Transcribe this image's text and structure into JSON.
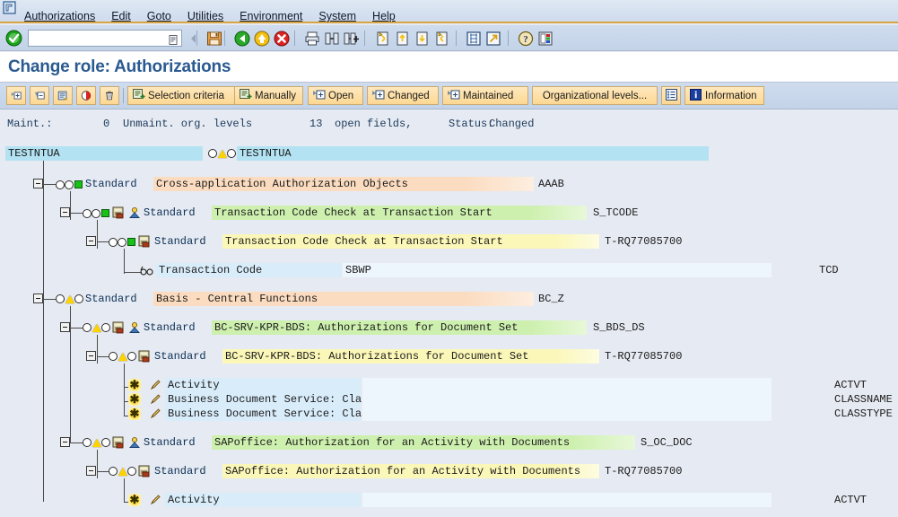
{
  "window": {
    "system_icon": "sap-window-icon"
  },
  "menubar": {
    "items": [
      {
        "label": "Authorizations",
        "accel": 0
      },
      {
        "label": "Edit",
        "accel": 0
      },
      {
        "label": "Goto",
        "accel": 0
      },
      {
        "label": "Utilities",
        "accel": 0
      },
      {
        "label": "Environment",
        "accel": 4
      },
      {
        "label": "System",
        "accel": 0
      },
      {
        "label": "Help",
        "accel": 0
      }
    ]
  },
  "toolbar": {
    "ok_icon": "enter-check-icon",
    "command_field": {
      "value": "",
      "placeholder": ""
    },
    "command_dropdown_icon": "command-history-icon",
    "buttons": [
      {
        "name": "back-small-icon",
        "glyph": "◀"
      },
      {
        "name": "save-icon",
        "glyph": "💾"
      },
      {
        "name": "back-green-icon",
        "glyph": "⬅"
      },
      {
        "name": "exit-yellow-icon",
        "glyph": "⬆"
      },
      {
        "name": "cancel-red-icon",
        "glyph": "✖"
      },
      {
        "name": "print-icon",
        "glyph": "🖨"
      },
      {
        "name": "find-icon",
        "glyph": "🔍"
      },
      {
        "name": "find-next-icon",
        "glyph": "🔎"
      },
      {
        "name": "first-page-icon",
        "glyph": "⏮"
      },
      {
        "name": "previous-page-icon",
        "glyph": "⬆"
      },
      {
        "name": "next-page-icon",
        "glyph": "⬇"
      },
      {
        "name": "last-page-icon",
        "glyph": "⏭"
      },
      {
        "name": "create-session-icon",
        "glyph": "▦"
      },
      {
        "name": "create-shortcut-icon",
        "glyph": "↗"
      },
      {
        "name": "help-icon",
        "glyph": "?"
      },
      {
        "name": "customize-local-layout-icon",
        "glyph": "▤"
      }
    ]
  },
  "title": {
    "text": "Change role: Authorizations"
  },
  "app_toolbar": {
    "icon_buttons": [
      {
        "name": "expand-all-button",
        "icon": "expand-node-icon"
      },
      {
        "name": "collapse-all-button",
        "icon": "collapse-node-icon"
      },
      {
        "name": "display-legend-button",
        "icon": "legend-icon"
      },
      {
        "name": "deactivate-button",
        "icon": "traffic-light-icon"
      },
      {
        "name": "delete-button",
        "icon": "trash-icon"
      }
    ],
    "labeled_buttons": [
      {
        "name": "selection-criteria-button",
        "label": "Selection criteria",
        "icon": "selection-icon"
      },
      {
        "name": "manually-button",
        "label": "Manually",
        "icon": "manual-icon"
      },
      {
        "name": "open-button",
        "label": "Open",
        "icon": "open-node-icon"
      },
      {
        "name": "changed-button",
        "label": "Changed",
        "icon": "changed-node-icon"
      },
      {
        "name": "maintained-button",
        "label": "Maintained",
        "icon": "maintained-node-icon"
      },
      {
        "name": "organizational-levels-button",
        "label": "Organizational levels...",
        "icon": ""
      },
      {
        "name": "utilities-list-button",
        "label": "",
        "icon": "list-icon"
      },
      {
        "name": "information-button",
        "label": "Information",
        "icon": "info-icon"
      }
    ]
  },
  "status_line": {
    "maint_label": "Maint.:",
    "unmaint_count": "0",
    "unmaint_label": "Unmaint. org. levels",
    "open_count": "13",
    "open_label": "open fields,",
    "status_label": "Status:",
    "status_value": "Changed"
  },
  "tree": {
    "role_name_left": "TESTNTUA",
    "role_name_right": "TESTNTUA",
    "role_status_icons": [
      "circle-white",
      "triangle-yellow",
      "circle-white"
    ],
    "rows": [
      {
        "kind": "role",
        "depth": 0,
        "left_text": "TESTNTUA",
        "status": [
          "circle-white",
          "triangle-yellow",
          "circle-white"
        ],
        "text": "TESTNTUA",
        "tech": ""
      },
      {
        "kind": "class",
        "depth": 1,
        "status": [
          "circle-white",
          "circle-white",
          "square-green"
        ],
        "standard": "Standard",
        "text": "Cross-application Authorization Objects",
        "tech": "AAAB"
      },
      {
        "kind": "object",
        "depth": 2,
        "status": [
          "circle-white",
          "circle-white",
          "square-green"
        ],
        "icons": [
          "auth-object-icon",
          "person-icon"
        ],
        "standard": "Standard",
        "text": "Transaction Code Check at Transaction Start",
        "tech": "S_TCODE"
      },
      {
        "kind": "auth",
        "depth": 3,
        "status": [
          "circle-white",
          "circle-white",
          "square-green"
        ],
        "icons": [
          "authorization-icon"
        ],
        "standard": "Standard",
        "text": "Transaction Code Check at Transaction Start",
        "tech": "T-RQ77085700"
      },
      {
        "kind": "field",
        "depth": 4,
        "icons": [
          "read-only-glasses-icon"
        ],
        "text": "Transaction Code",
        "value": "SBWP",
        "tech": "TCD"
      },
      {
        "kind": "class",
        "depth": 1,
        "status": [
          "circle-white",
          "triangle-yellow",
          "circle-white"
        ],
        "standard": "Standard",
        "text": "Basis - Central Functions",
        "tech": "BC_Z"
      },
      {
        "kind": "object",
        "depth": 2,
        "status": [
          "circle-white",
          "triangle-yellow",
          "circle-white"
        ],
        "icons": [
          "auth-object-icon",
          "person-icon"
        ],
        "standard": "Standard",
        "text": "BC-SRV-KPR-BDS: Authorizations for Document Set",
        "tech": "S_BDS_DS"
      },
      {
        "kind": "auth",
        "depth": 3,
        "status": [
          "circle-white",
          "triangle-yellow",
          "circle-white"
        ],
        "icons": [
          "authorization-icon"
        ],
        "standard": "Standard",
        "text": "BC-SRV-KPR-BDS: Authorizations for Document Set",
        "tech": "T-RQ77085700"
      },
      {
        "kind": "field",
        "depth": 4,
        "icons": [
          "star-icon",
          "pencil-icon"
        ],
        "text": "Activity",
        "value": "",
        "tech": "ACTVT"
      },
      {
        "kind": "field",
        "depth": 4,
        "icons": [
          "star-icon",
          "pencil-icon"
        ],
        "text": "Business Document Service: Cla",
        "value": "",
        "tech": "CLASSNAME"
      },
      {
        "kind": "field",
        "depth": 4,
        "icons": [
          "star-icon",
          "pencil-icon"
        ],
        "text": "Business Document Service: Cla",
        "value": "",
        "tech": "CLASSTYPE"
      },
      {
        "kind": "object",
        "depth": 2,
        "status": [
          "circle-white",
          "triangle-yellow",
          "circle-white"
        ],
        "icons": [
          "auth-object-icon",
          "person-icon"
        ],
        "standard": "Standard",
        "text": "SAPoffice: Authorization for an Activity with Documents",
        "tech": "S_OC_DOC"
      },
      {
        "kind": "auth",
        "depth": 3,
        "status": [
          "circle-white",
          "triangle-yellow",
          "circle-white"
        ],
        "icons": [
          "authorization-icon"
        ],
        "standard": "Standard",
        "text": "SAPoffice: Authorization for an Activity with Documents",
        "tech": "T-RQ77085700"
      },
      {
        "kind": "field",
        "depth": 4,
        "icons": [
          "star-icon",
          "pencil-icon"
        ],
        "text": "Activity",
        "value": "",
        "tech": "ACTVT"
      }
    ]
  },
  "colors": {
    "accent_orange": "#d9a441",
    "title_blue": "#2a5a90",
    "class_bg": "#fbdcc0",
    "object_bg": "#cdf0ae",
    "auth_bg": "#fbf7b8",
    "field_bg": "#d9ecfa",
    "role_bg": "#b3e2f2",
    "green_status": "#17c217",
    "yellow_status": "#ffd300"
  }
}
